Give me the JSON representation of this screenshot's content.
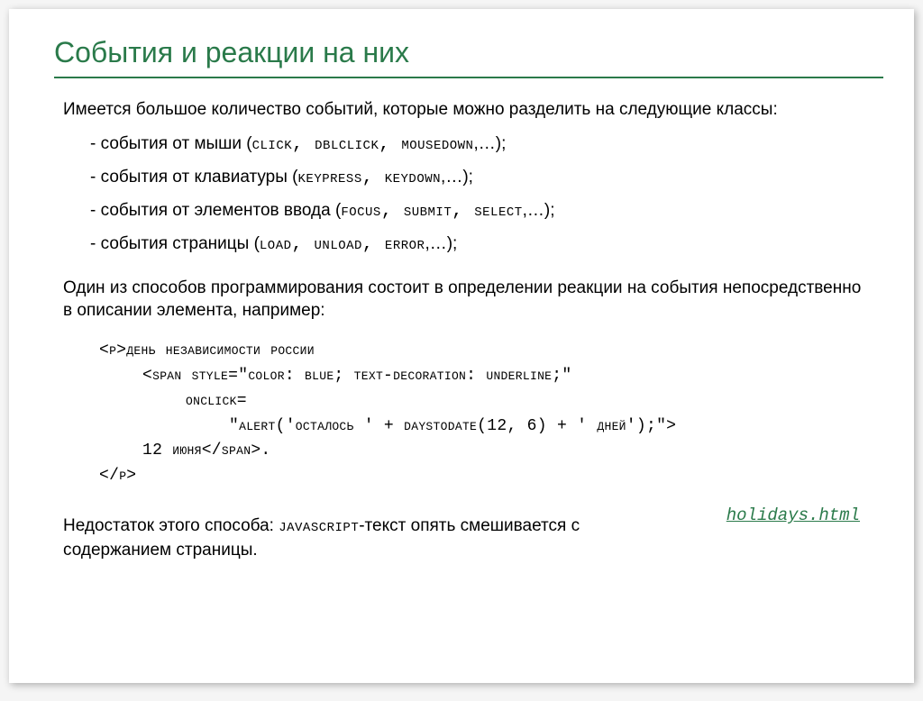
{
  "title": "События и реакции на них",
  "intro": "Имеется большое количество событий, которые можно разделить на следующие классы:",
  "events": {
    "mouse": {
      "prefix": "- события от мыши (",
      "list": "click, dblclick, mousedown",
      "suffix": ",…);"
    },
    "keyboard": {
      "prefix": "- события от клавиатуры (",
      "list": "keypress, keydown",
      "suffix": ",…);"
    },
    "input": {
      "prefix": "- события от элементов ввода (",
      "list": "focus, submit, select",
      "suffix": ",…);"
    },
    "page": {
      "prefix": "- события страницы (",
      "list": "load, unload, error",
      "suffix": ",…);"
    }
  },
  "para2": "Один из способов программирования состоит в определении реакции на события непосредственно в описании элемента, например:",
  "code": {
    "l1": "<p>День независимости России",
    "l2": "<span style=\"color: blue; text-decoration: underline;\"",
    "l3": "onclick=",
    "l4": "\"alert('Осталось ' + daysToDate(12, 6) + ' дней');\">",
    "l5": "12 июня</span>.",
    "l6": "</p>"
  },
  "drawback": {
    "p1": "Недостаток этого способа: ",
    "mono": "javascript",
    "p2": "-текст опять смешивается с содержанием страницы."
  },
  "link": "holidays.html"
}
